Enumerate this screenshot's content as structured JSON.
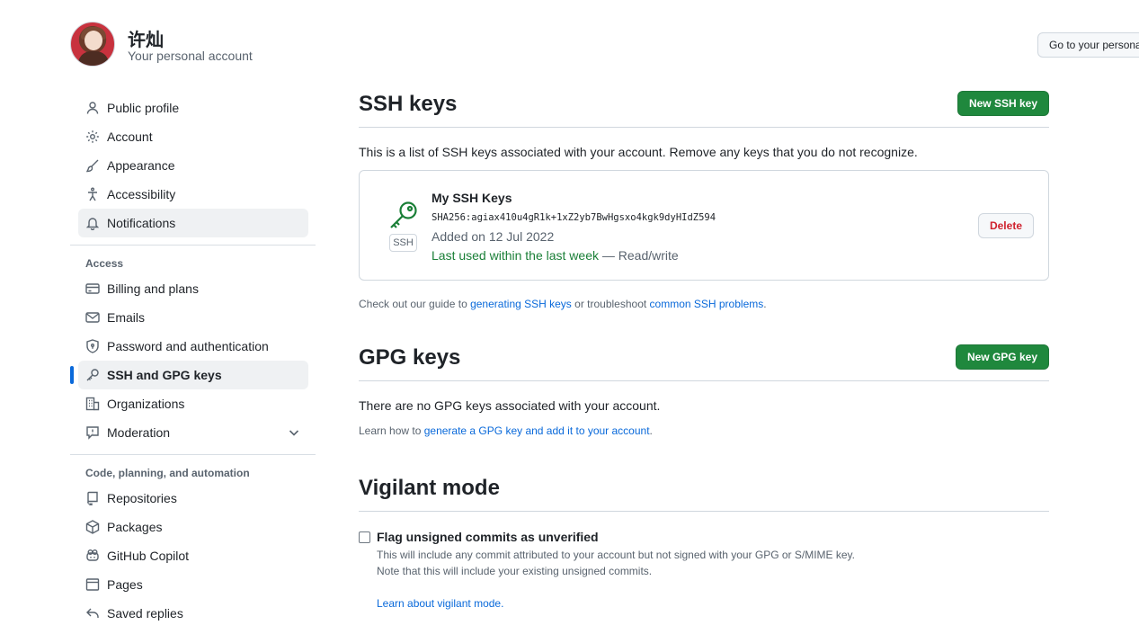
{
  "header": {
    "user_name": "许灿",
    "user_sub": "Your personal account",
    "goto_button": "Go to your personal profile"
  },
  "sidebar": {
    "items": [
      {
        "label": "Public profile",
        "icon": "person-icon"
      },
      {
        "label": "Account",
        "icon": "gear-icon"
      },
      {
        "label": "Appearance",
        "icon": "paintbrush-icon"
      },
      {
        "label": "Accessibility",
        "icon": "accessibility-icon"
      },
      {
        "label": "Notifications",
        "icon": "bell-icon"
      }
    ],
    "access_label": "Access",
    "access_items": [
      {
        "label": "Billing and plans",
        "icon": "credit-card-icon"
      },
      {
        "label": "Emails",
        "icon": "mail-icon"
      },
      {
        "label": "Password and authentication",
        "icon": "shield-lock-icon"
      },
      {
        "label": "SSH and GPG keys",
        "icon": "key-icon"
      },
      {
        "label": "Organizations",
        "icon": "organization-icon"
      },
      {
        "label": "Moderation",
        "icon": "report-icon"
      }
    ],
    "code_label": "Code, planning, and automation",
    "code_items": [
      {
        "label": "Repositories",
        "icon": "repo-icon"
      },
      {
        "label": "Packages",
        "icon": "package-icon"
      },
      {
        "label": "GitHub Copilot",
        "icon": "copilot-icon"
      },
      {
        "label": "Pages",
        "icon": "browser-icon"
      },
      {
        "label": "Saved replies",
        "icon": "reply-icon"
      }
    ]
  },
  "ssh": {
    "title": "SSH keys",
    "new_button": "New SSH key",
    "description": "This is a list of SSH keys associated with your account. Remove any keys that you do not recognize.",
    "key": {
      "name": "My SSH Keys",
      "tag": "SSH",
      "fingerprint": "SHA256:agiax410u4gR1k+1xZ2yb7BwHgsxo4kgk9dyHIdZ594",
      "added": "Added on 12 Jul 2022",
      "last_used": "Last used within the last week",
      "access": " — Read/write",
      "delete_button": "Delete"
    },
    "guide_prefix": "Check out our guide to ",
    "guide_link1": "generating SSH keys",
    "guide_mid": " or troubleshoot ",
    "guide_link2": "common SSH problems",
    "guide_suffix": "."
  },
  "gpg": {
    "title": "GPG keys",
    "new_button": "New GPG key",
    "description": "There are no GPG keys associated with your account.",
    "learn_prefix": "Learn how to ",
    "learn_link": "generate a GPG key and add it to your account",
    "learn_suffix": "."
  },
  "vigilant": {
    "title": "Vigilant mode",
    "checkbox_label": "Flag unsigned commits as unverified",
    "note1": "This will include any commit attributed to your account but not signed with your GPG or S/MIME key.",
    "note2": "Note that this will include your existing unsigned commits.",
    "learn_link": "Learn about vigilant mode."
  },
  "colors": {
    "accent": "#0969da",
    "primary_button": "#1f883d",
    "danger": "#cf222e",
    "success_text": "#1a7f37"
  }
}
